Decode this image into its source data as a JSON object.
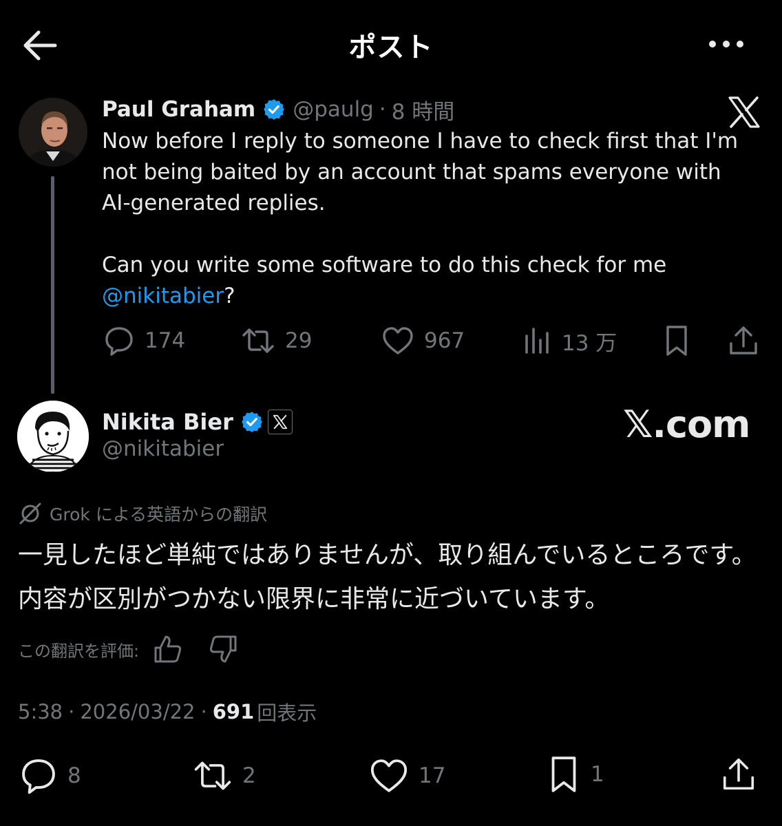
{
  "header": {
    "title": "ポスト",
    "back_icon": "arrow-left-icon",
    "more_icon": "more-horizontal-icon"
  },
  "colors": {
    "background": "#000000",
    "text": "#e7e9ea",
    "muted": "#71767b",
    "link": "#1d9bf0",
    "verified": "#1d9bf0"
  },
  "tweet1": {
    "author_name": "Paul Graham",
    "handle": "@paulg",
    "separator": "·",
    "time": "8 時間",
    "text_p1": "Now before I reply to someone I have to check first that I'm not being baited by an account that spams everyone with AI-generated replies.",
    "text_p2_pre": "Can you write some software to do this check for me ",
    "mention": "@nikitabier",
    "text_p2_post": "?",
    "replies": "174",
    "reposts": "29",
    "likes": "967",
    "views": "13 万"
  },
  "tweet2": {
    "author_name": "Nikita Bier",
    "handle": "@nikitabier",
    "watermark": "𝕏.com",
    "translation_label": "Grok による英語からの翻訳",
    "text": "一見したほど単純ではありませんが、取り組んでいるところです。内容が区別がつかない限界に非常に近づいています。",
    "rate_label": "この翻訳を評価:",
    "time": "5:38",
    "separator": "·",
    "date": "2026/03/22",
    "view_count": "691",
    "views_label": "回表示",
    "replies": "8",
    "reposts": "2",
    "likes": "17",
    "bookmarks": "1"
  }
}
